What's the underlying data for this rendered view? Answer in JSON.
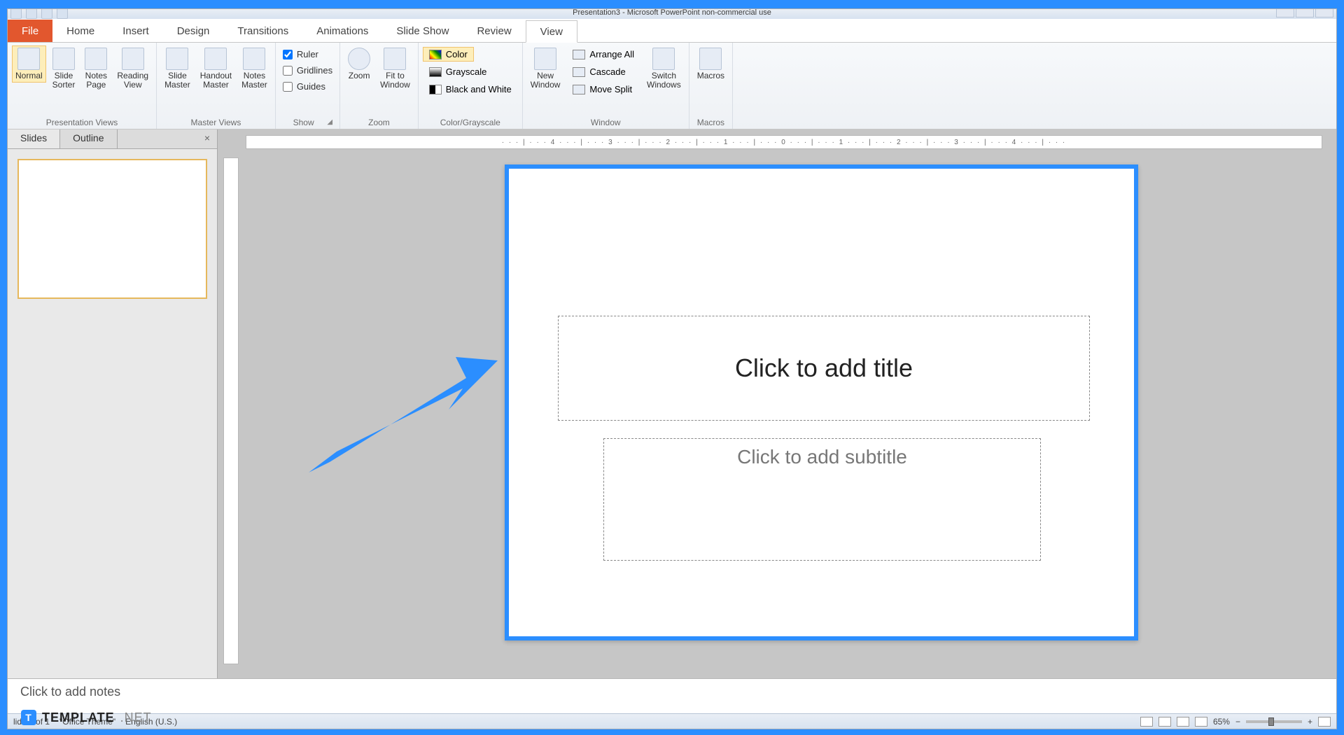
{
  "title": "Presentation3 - Microsoft PowerPoint non-commercial use",
  "tabs": {
    "file": "File",
    "list": [
      "Home",
      "Insert",
      "Design",
      "Transitions",
      "Animations",
      "Slide Show",
      "Review",
      "View"
    ],
    "active": "View"
  },
  "ribbon": {
    "presentation_views": {
      "label": "Presentation Views",
      "normal": "Normal",
      "sorter": "Slide\nSorter",
      "notes": "Notes\nPage",
      "reading": "Reading\nView"
    },
    "master_views": {
      "label": "Master Views",
      "slide": "Slide\nMaster",
      "handout": "Handout\nMaster",
      "notes": "Notes\nMaster"
    },
    "show": {
      "label": "Show",
      "ruler": "Ruler",
      "gridlines": "Gridlines",
      "guides": "Guides"
    },
    "zoom": {
      "label": "Zoom",
      "zoom": "Zoom",
      "fit": "Fit to\nWindow"
    },
    "color": {
      "label": "Color/Grayscale",
      "color": "Color",
      "gray": "Grayscale",
      "bw": "Black and White"
    },
    "window": {
      "label": "Window",
      "new": "New\nWindow",
      "arrange": "Arrange All",
      "cascade": "Cascade",
      "split": "Move Split",
      "switch": "Switch\nWindows"
    },
    "macros": {
      "label": "Macros",
      "macros": "Macros"
    }
  },
  "panel": {
    "slides": "Slides",
    "outline": "Outline",
    "close": "×"
  },
  "ruler_h": "· · · | · · · 4 · · · | · · · 3 · · · | · · · 2 · · · | · · · 1 · · · | · · · 0 · · · | · · · 1 · · · | · · · 2 · · · | · · · 3 · · · | · · · 4 · · · | · · ·",
  "slide": {
    "title": "Click to add title",
    "subtitle": "Click to add subtitle"
  },
  "notes": "Click to add notes",
  "status": {
    "slide": "lide 1 of 1",
    "theme": "\"Office Theme\"",
    "lang": "English (U.S.)",
    "zoom": "65%"
  },
  "watermark": {
    "brand": "TEMPLATE",
    "net": ".NET"
  }
}
